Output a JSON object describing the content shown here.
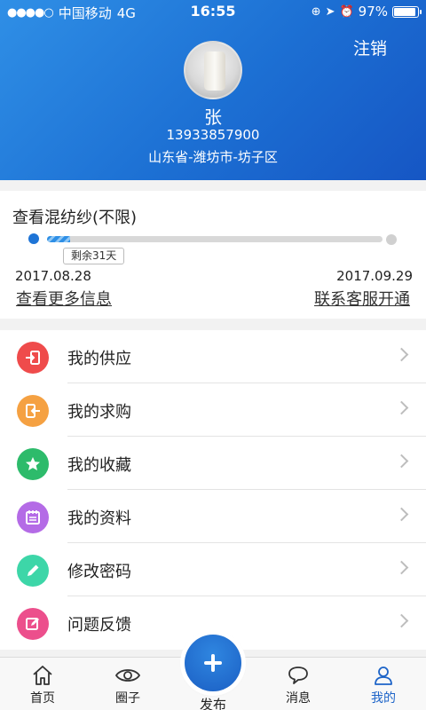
{
  "status_bar": {
    "carrier": "中国移动",
    "network": "4G",
    "time": "16:55",
    "battery": "97%"
  },
  "header": {
    "logout_label": "注销",
    "user_name": "张",
    "phone": "13933857900",
    "address": "山东省-潍坊市-坊子区"
  },
  "subscription": {
    "title": "查看混纺纱(不限)",
    "progress_fraction": 0.07,
    "remaining": "剩余31天",
    "start_date": "2017.08.28",
    "end_date": "2017.09.29",
    "more_info_link": "查看更多信息",
    "contact_link": "联系客服开通"
  },
  "menu": {
    "items": [
      {
        "label": "我的供应",
        "icon": "supply-icon",
        "color": "#ef4b4b"
      },
      {
        "label": "我的求购",
        "icon": "purchase-icon",
        "color": "#f5a142"
      },
      {
        "label": "我的收藏",
        "icon": "star-icon",
        "color": "#2dbb6b"
      },
      {
        "label": "我的资料",
        "icon": "profile-icon",
        "color": "#b46be6"
      },
      {
        "label": "修改密码",
        "icon": "pencil-icon",
        "color": "#3dd6a8"
      },
      {
        "label": "问题反馈",
        "icon": "feedback-icon",
        "color": "#ec4f8c"
      }
    ]
  },
  "bottom_nav": {
    "home": "首页",
    "circle": "圈子",
    "publish": "发布",
    "messages": "消息",
    "mine": "我的",
    "active_color": "#1d64c8"
  }
}
